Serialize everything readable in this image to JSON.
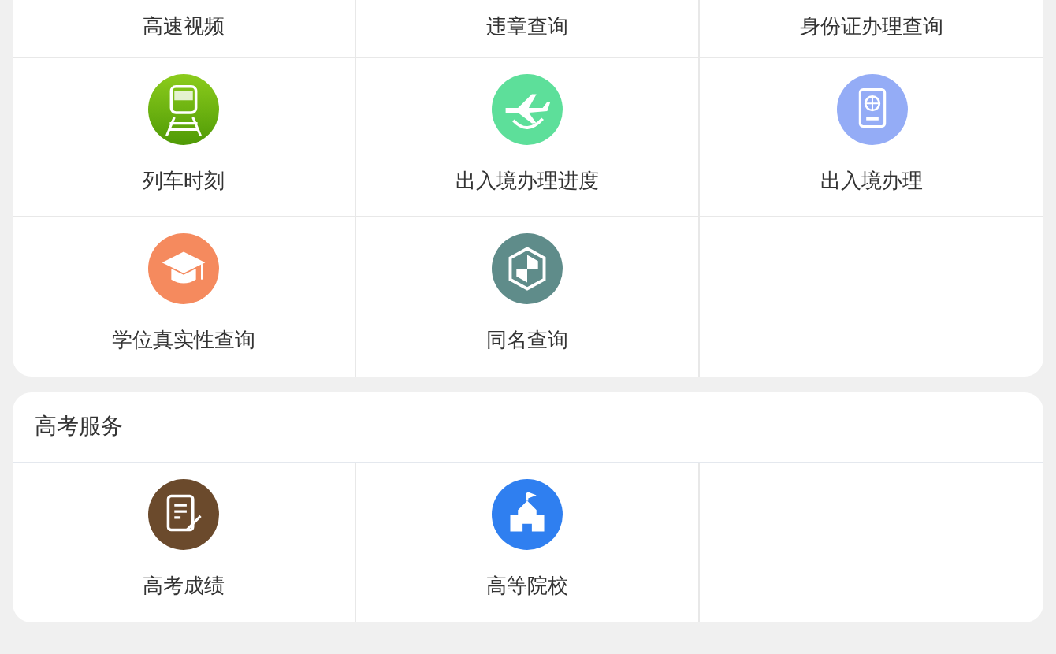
{
  "sections": [
    {
      "items": [
        {
          "label": "高速视频",
          "kind": "text"
        },
        {
          "label": "违章查询",
          "kind": "text"
        },
        {
          "label": "身份证办理查询",
          "kind": "text"
        },
        {
          "label": "列车时刻",
          "kind": "train"
        },
        {
          "label": "出入境办理进度",
          "kind": "plane"
        },
        {
          "label": "出入境办理",
          "kind": "passport"
        },
        {
          "label": "学位真实性查询",
          "kind": "graduation"
        },
        {
          "label": "同名查询",
          "kind": "hexagon"
        }
      ]
    },
    {
      "title": "高考服务",
      "items": [
        {
          "label": "高考成绩",
          "kind": "document"
        },
        {
          "label": "高等院校",
          "kind": "school"
        }
      ]
    }
  ]
}
